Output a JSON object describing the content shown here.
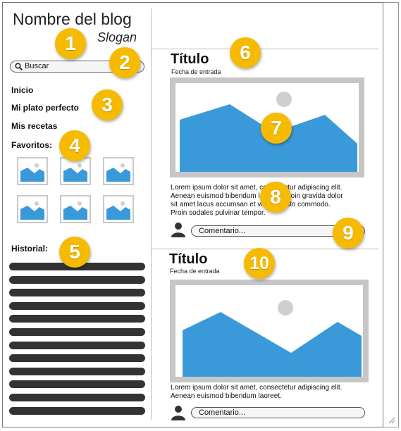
{
  "sidebar": {
    "blog_title": "Nombre del blog",
    "slogan": "Slogan",
    "search_placeholder": "Buscar",
    "nav": [
      "Inicio",
      "Mi plato perfecto",
      "Mis recetas"
    ],
    "favorites_label": "Favoritos:",
    "history_label": "Historial:",
    "history_items": 12
  },
  "posts": [
    {
      "title": "Título",
      "date_label": "Fecha de entrada",
      "body_lines": [
        "Lorem ipsum dolor sit amet, consectetur adipiscing elit.",
        "Aenean euismod bibendum laoreet. Proin gravida dolor",
        "sit amet lacus accumsan et viverra justo commodo.",
        "Proin sodales pulvinar tempor."
      ],
      "comment_placeholder": "Comentario..."
    },
    {
      "title": "Título",
      "date_label": "Fecha de entrada",
      "body_lines": [
        "Lorem ipsum dolor sit amet, consectetur adipiscing elit.",
        "Aenean euismod bibendum laoreet."
      ],
      "comment_placeholder": "Comentario..."
    }
  ],
  "badges": [
    "1",
    "2",
    "3",
    "4",
    "5",
    "6",
    "7",
    "8",
    "9",
    "10"
  ],
  "colors": {
    "badge": "#f6bb00",
    "image_blue": "#3a9ad9",
    "image_frame": "#c6c6c6",
    "history_bar": "#333333"
  }
}
